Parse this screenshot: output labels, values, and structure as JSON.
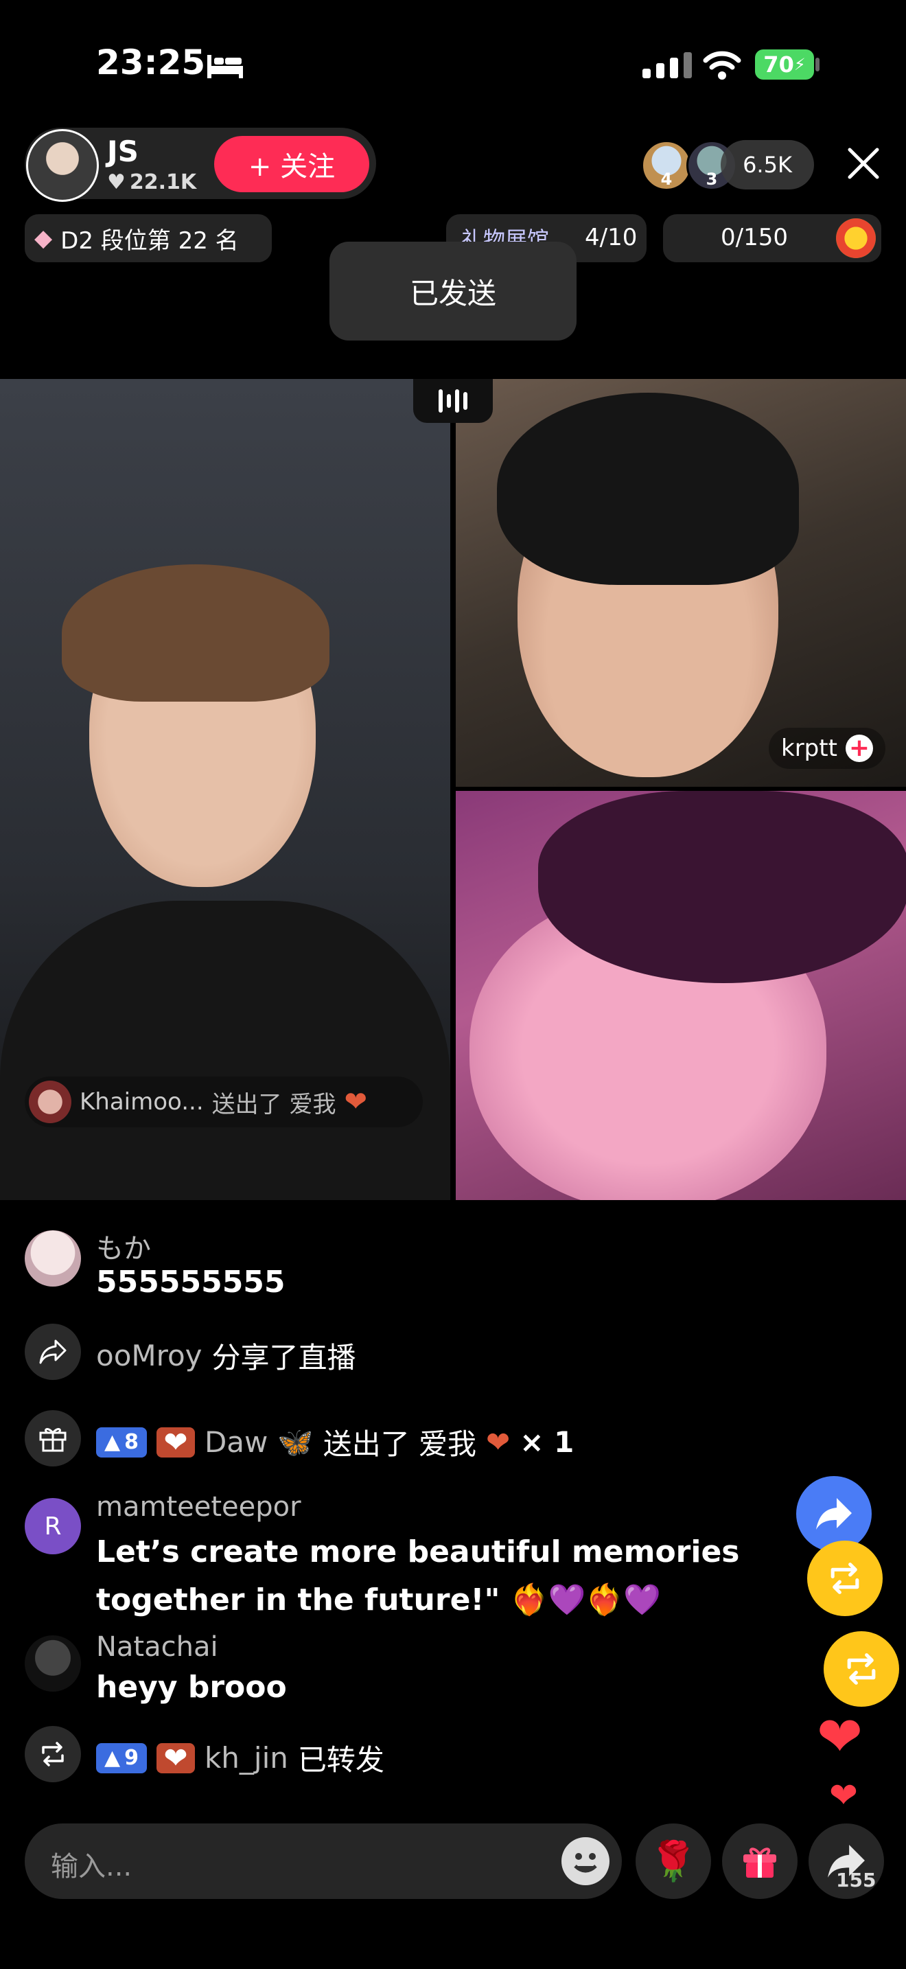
{
  "status_bar": {
    "time": "23:25",
    "battery": "70"
  },
  "host": {
    "name": "JS",
    "likes": "22.1K",
    "follow_label": "+ 关注"
  },
  "viewers": {
    "avatar1_rank": "4",
    "avatar2_rank": "3",
    "count": "6.5K"
  },
  "rank": {
    "label": "D2 段位第 22 名"
  },
  "gift_hall": {
    "label": "礼物展馆",
    "count": "4/10"
  },
  "goal": {
    "count": "0/150"
  },
  "toast": "已发送",
  "guest": {
    "name": "krptt"
  },
  "gift_banner": {
    "user": "Khaimoo...",
    "action": "送出了 爱我"
  },
  "comments": [
    {
      "user": "もか",
      "text": "555555555"
    },
    {
      "user": "ooMroy",
      "text": "分享了直播"
    },
    {
      "level": "8",
      "user": "Daw",
      "text": "送出了 爱我",
      "suffix": "× 1"
    },
    {
      "avatar_letter": "R",
      "user": "mamteeteepor",
      "text": "Let’s create more beautiful memories together in the future!\""
    },
    {
      "user": "Natachai",
      "text": "heyy brooo"
    },
    {
      "level": "9",
      "user": "kh_jin",
      "text": "已转发"
    }
  ],
  "input": {
    "placeholder": "输入..."
  },
  "share": {
    "count": "155"
  },
  "colors": {
    "accent": "#fe2c55",
    "level_badge": "#3b6ce0",
    "repost": "#ffc61a"
  }
}
